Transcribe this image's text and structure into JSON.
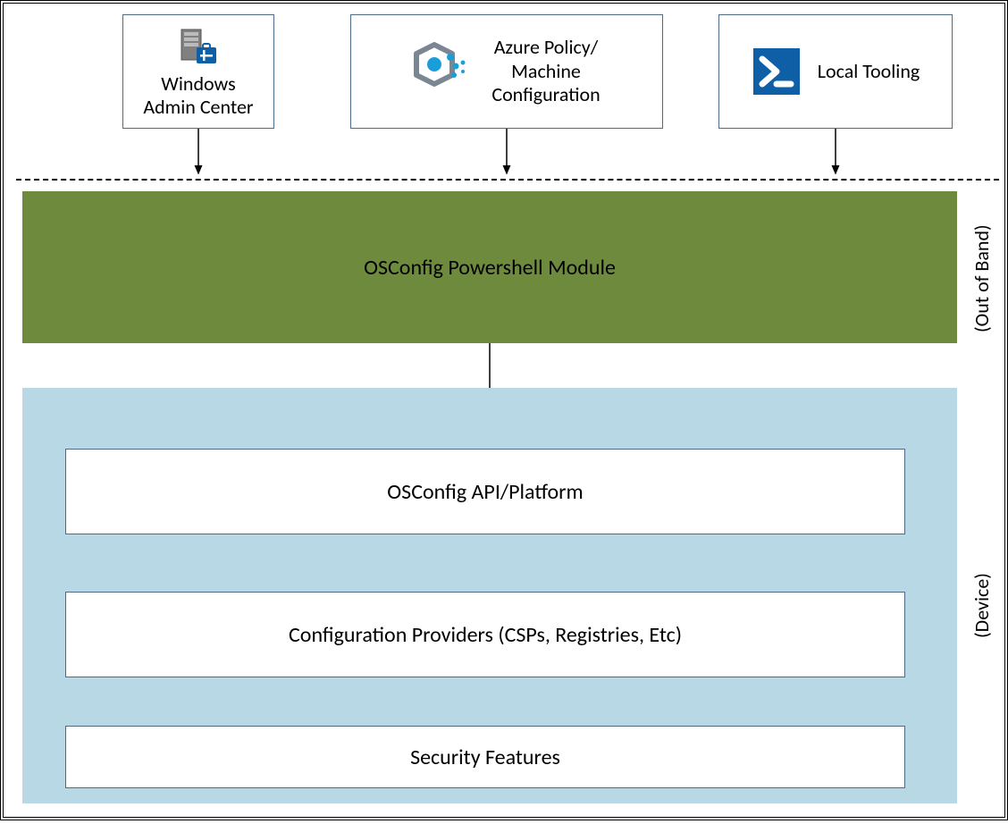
{
  "top": [
    {
      "label1": "Windows",
      "label2": "Admin Center",
      "icon": "server"
    },
    {
      "label1": "Azure Policy/",
      "label2": "Machine",
      "label3": "Configuration",
      "icon": "azure-policy"
    },
    {
      "label1": "Local Tooling",
      "icon": "powershell"
    }
  ],
  "greenBand": "OSConfig Powershell Module",
  "inner": [
    "OSConfig API/Platform",
    "Configuration Providers (CSPs, Registries, Etc)",
    "Security Features"
  ],
  "sideLabels": {
    "outOfBand": "(Out of Band)",
    "device": "(Device)"
  }
}
